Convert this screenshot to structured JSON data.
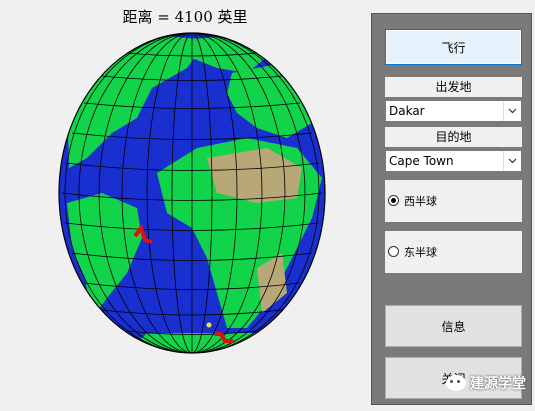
{
  "figure": {
    "title": "距离 = 4100 英里"
  },
  "controls": {
    "fly_button": "飞行",
    "origin_label": "出发地",
    "origin_value": "Dakar",
    "destination_label": "目的地",
    "destination_value": "Cape Town",
    "west_hemisphere": "西半球",
    "east_hemisphere": "东半球",
    "west_checked": true,
    "info_button": "信息",
    "close_button": "关闭"
  },
  "watermark": {
    "text": "建源学堂"
  },
  "colors": {
    "ocean": "#1a2fd0",
    "land": "#12d44a",
    "desert": "#b8a878",
    "marker": "#e01010",
    "panel": "#7a7a7a"
  }
}
